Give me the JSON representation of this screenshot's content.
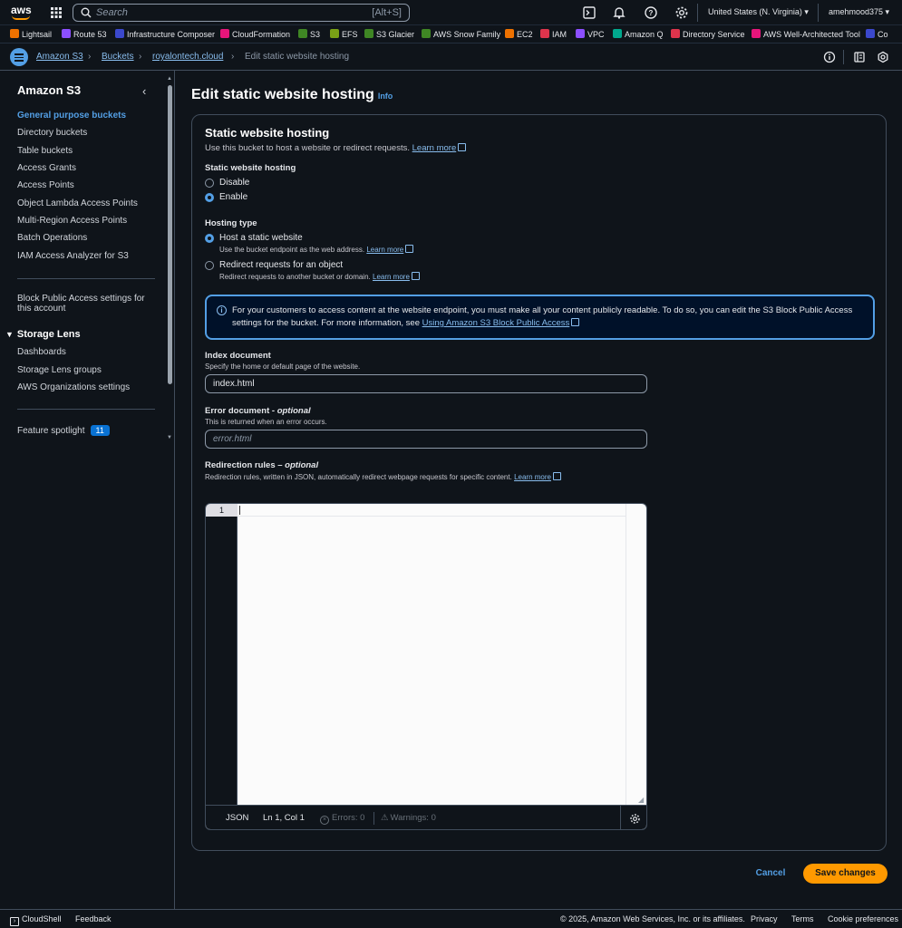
{
  "topnav": {
    "search_placeholder": "Search",
    "search_shortcut": "[Alt+S]",
    "region": "United States (N. Virginia) ▾",
    "account": "amehmood375 ▾",
    "icons": [
      "aws-logo",
      "apps-grid-icon",
      "cloudshell-icon",
      "bell-icon",
      "help-icon",
      "gear-icon"
    ]
  },
  "favorites": [
    {
      "label": "Lightsail",
      "color": "#ed7100"
    },
    {
      "label": "Route 53",
      "color": "#8c4fff"
    },
    {
      "label": "Infrastructure Composer",
      "color": "#3b48cc"
    },
    {
      "label": "CloudFormation",
      "color": "#e7157b"
    },
    {
      "label": "S3",
      "color": "#3f8624"
    },
    {
      "label": "EFS",
      "color": "#7aa116"
    },
    {
      "label": "S3 Glacier",
      "color": "#3f8624"
    },
    {
      "label": "AWS Snow Family",
      "color": "#3f8624"
    },
    {
      "label": "EC2",
      "color": "#ed7100"
    },
    {
      "label": "IAM",
      "color": "#dd344c"
    },
    {
      "label": "VPC",
      "color": "#8c4fff"
    },
    {
      "label": "Amazon Q",
      "color": "#01a88d"
    },
    {
      "label": "Directory Service",
      "color": "#dd344c"
    },
    {
      "label": "AWS Well-Architected Tool",
      "color": "#e7157b"
    },
    {
      "label": "Co",
      "color": "#3b48cc"
    }
  ],
  "breadcrumbs": {
    "items": [
      "Amazon S3",
      "Buckets",
      "royalontech.cloud"
    ],
    "current": "Edit static website hosting"
  },
  "sidebar": {
    "title": "Amazon S3",
    "items": [
      "General purpose buckets",
      "Directory buckets",
      "Table buckets",
      "Access Grants",
      "Access Points",
      "Object Lambda Access Points",
      "Multi-Region Access Points",
      "Batch Operations",
      "IAM Access Analyzer for S3"
    ],
    "block_public_line1": "Block Public Access settings for",
    "block_public_line2": "this account",
    "storage_lens": {
      "heading": "Storage Lens",
      "items": [
        "Dashboards",
        "Storage Lens groups",
        "AWS Organizations settings"
      ]
    },
    "feature_spotlight": "Feature spotlight",
    "feature_count": "11"
  },
  "page": {
    "title": "Edit static website hosting",
    "info": "Info"
  },
  "panel": {
    "title": "Static website hosting",
    "description": "Use this bucket to host a website or redirect requests.",
    "learn_more": "Learn more",
    "hosting_label": "Static website hosting",
    "disable": "Disable",
    "enable": "Enable",
    "hosting_type_label": "Hosting type",
    "host_static": "Host a static website",
    "host_static_desc": "Use the bucket endpoint as the web address.",
    "redirect": "Redirect requests for an object",
    "redirect_desc": "Redirect requests to another bucket or domain.",
    "alert_text": "For your customers to access content at the website endpoint, you must make all your content publicly readable. To do so, you can edit the S3 Block Public Access settings for the bucket. For more information, see",
    "alert_link": "Using Amazon S3 Block Public Access",
    "index_label": "Index document",
    "index_desc": "Specify the home or default page of the website.",
    "index_value": "index.html",
    "error_label": "Error document -",
    "error_optional": "optional",
    "error_desc": "This is returned when an error occurs.",
    "error_placeholder": "error.html",
    "redirect_rules_label": "Redirection rules –",
    "redirect_rules_optional": "optional",
    "redirect_rules_desc": "Redirection rules, written in JSON, automatically redirect webpage requests for specific content."
  },
  "editor": {
    "line_number": "1",
    "mode": "JSON",
    "position": "Ln 1, Col 1",
    "errors": "Errors: 0",
    "warnings": "Warnings: 0"
  },
  "actions": {
    "cancel": "Cancel",
    "save": "Save changes"
  },
  "footer": {
    "cloudshell": "CloudShell",
    "feedback": "Feedback",
    "copyright": "© 2025, Amazon Web Services, Inc. or its affiliates.",
    "privacy": "Privacy",
    "terms": "Terms",
    "cookies": "Cookie preferences"
  }
}
